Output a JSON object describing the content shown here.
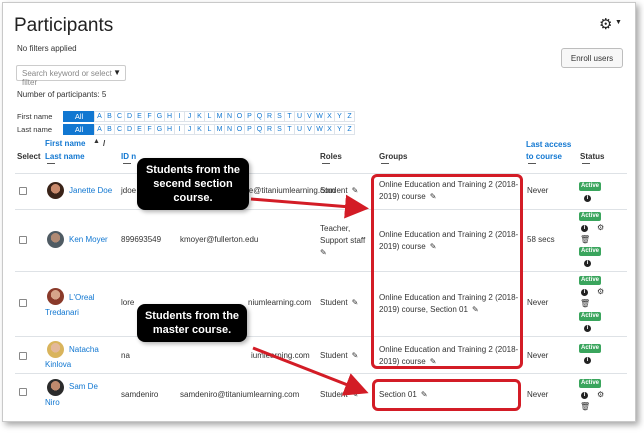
{
  "page": {
    "title": "Participants",
    "filters_text": "No filters applied",
    "enroll_label": "Enroll users",
    "search_placeholder": "Search keyword or select filter",
    "participant_count": "Number of participants: 5"
  },
  "letter_filter": {
    "first_name_label": "First name",
    "last_name_label": "Last name",
    "all_label": "All",
    "letters": [
      "A",
      "B",
      "C",
      "D",
      "E",
      "F",
      "G",
      "H",
      "I",
      "J",
      "K",
      "L",
      "M",
      "N",
      "O",
      "P",
      "Q",
      "R",
      "S",
      "T",
      "U",
      "V",
      "W",
      "X",
      "Y",
      "Z"
    ]
  },
  "table": {
    "headers": {
      "select": "Select",
      "first_name": "First name",
      "sort_separator": "/",
      "last_name": "Last name",
      "id": "ID n",
      "roles": "Roles",
      "groups": "Groups",
      "last_access": "Last access to course",
      "status": "Status"
    },
    "rows": [
      {
        "first": "Janette Doe",
        "last": "",
        "id": "jdoe",
        "email": "nt.doe@titaniumlearning.com",
        "roles": "Student",
        "groups": "Online Education and Training 2 (2018-2019) course",
        "access": "Never",
        "status": "Active"
      },
      {
        "first": "Ken Moyer",
        "last": "",
        "id": "899693549",
        "email": "kmoyer@fullerton.edu",
        "roles": "Teacher, Support staff",
        "groups": "Online Education and Training 2 (2018-2019) course",
        "access": "58 secs",
        "status": "Active"
      },
      {
        "first": "L'Oreal",
        "last": "Tredanari",
        "id": "lore",
        "email": "niumlearning.com",
        "roles": "Student",
        "groups": "Online Education and Training 2 (2018-2019) course, Section 01",
        "access": "Never",
        "status": "Active"
      },
      {
        "first": "Natacha",
        "last": "Kinlova",
        "id": "na",
        "email": "iumlearning.com",
        "roles": "Student",
        "groups": "Online Education and Training 2 (2018-2019) course",
        "access": "Never",
        "status": "Active"
      },
      {
        "first": "Sam De",
        "last": "Niro",
        "id": "samdeniro",
        "email": "samdeniro@titaniumlearning.com",
        "roles": "Student",
        "groups": "Section 01",
        "access": "Never",
        "status": "Active"
      }
    ]
  },
  "callouts": {
    "second_section": "Students from the secend section course.",
    "master": "Students from the master course."
  },
  "icons": {
    "gear": "gear-icon",
    "pencil": "pencil-icon",
    "info": "info-icon",
    "trash": "trash-icon",
    "sort": "sort-up-icon"
  },
  "colors": {
    "link": "#1177d1",
    "active": "#3aa55d",
    "highlight": "#d31c26",
    "callout": "#000000"
  }
}
